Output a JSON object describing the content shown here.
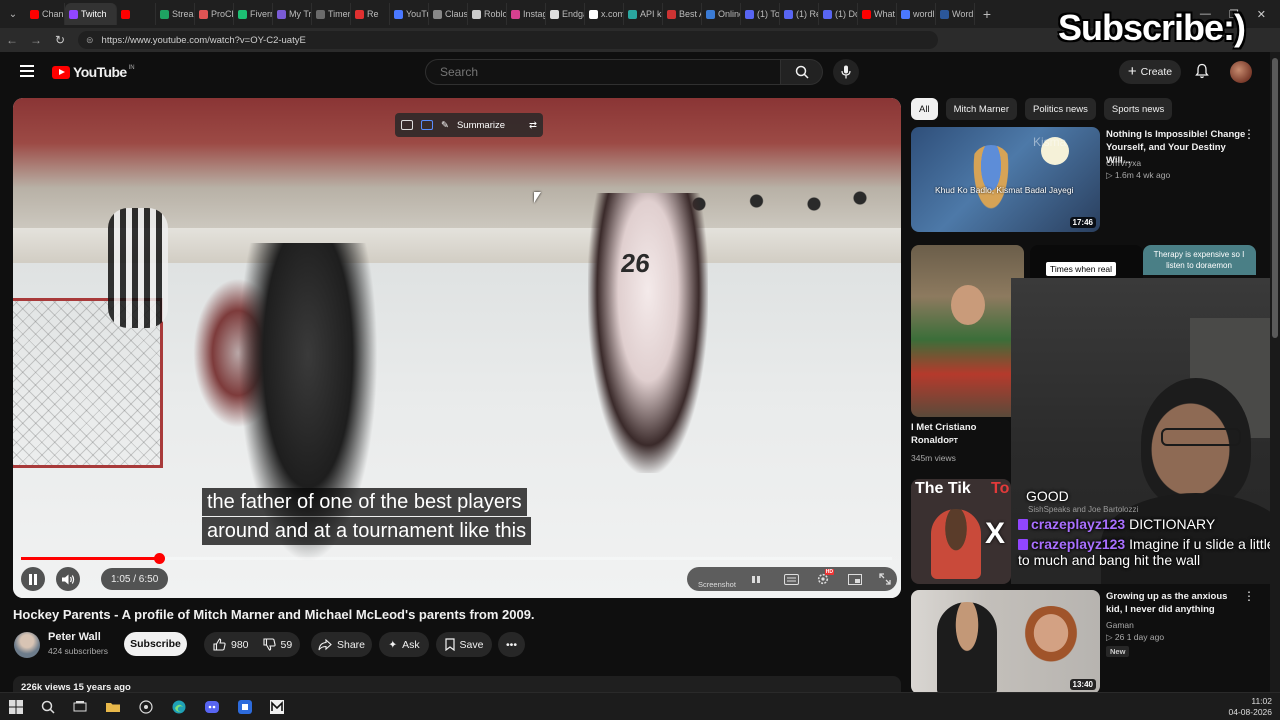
{
  "browser": {
    "tabs": [
      {
        "label": "Chann",
        "color": "#ff0000"
      },
      {
        "label": "Twitch",
        "color": "#9146ff",
        "active": true
      },
      {
        "label": "",
        "color": "#ff0000"
      },
      {
        "label": "Strean",
        "color": "#1ea362"
      },
      {
        "label": "ProCh",
        "color": "#e05454"
      },
      {
        "label": "Fiverr",
        "color": "#1dbf73"
      },
      {
        "label": "My Tr",
        "color": "#7a5bd6"
      },
      {
        "label": "Timers",
        "color": "#6a6a6a"
      },
      {
        "label": "Re",
        "color": "#e03030"
      },
      {
        "label": "YouTu",
        "color": "#4a78ff"
      },
      {
        "label": "Claust",
        "color": "#888888"
      },
      {
        "label": "Roblo",
        "color": "#cccccc"
      },
      {
        "label": "Instag",
        "color": "#d6408f"
      },
      {
        "label": "Endga",
        "color": "#dddddd"
      },
      {
        "label": "x.com",
        "color": "#ffffff"
      },
      {
        "label": "API ke",
        "color": "#2aa7a0"
      },
      {
        "label": "Best A",
        "color": "#cc3333"
      },
      {
        "label": "Onlinc",
        "color": "#3a7bd5"
      },
      {
        "label": "(1) To",
        "color": "#5865f2"
      },
      {
        "label": "(1) Re",
        "color": "#5865f2"
      },
      {
        "label": "(1) Dc",
        "color": "#5865f2"
      },
      {
        "label": "What i",
        "color": "#ff0000"
      },
      {
        "label": "wordli",
        "color": "#4a78ff"
      },
      {
        "label": "Word",
        "color": "#2b579a"
      }
    ],
    "url": "https://www.youtube.com/watch?v=OY-C2-uatyE"
  },
  "header": {
    "logo_text": "YouTube",
    "region": "IN",
    "search_placeholder": "Search",
    "create_label": "Create"
  },
  "player": {
    "toolbar_summarize": "Summarize",
    "caption_lines": [
      "the father of one of the best players",
      "around and at a tournament like this"
    ],
    "jersey_number": "26",
    "time_display": "1:05 / 6:50",
    "progress": 0.159,
    "screenshot_label": "Screenshot",
    "hd_badge": "HD"
  },
  "video": {
    "title": "Hockey Parents - A profile of Mitch Marner and Michael McLeod's parents from 2009.",
    "channel": "Peter Wall",
    "subscribers": "424 subscribers",
    "subscribe_label": "Subscribe",
    "likes": "980",
    "dislikes": "59",
    "share_label": "Share",
    "ask_label": "Ask",
    "save_label": "Save",
    "views_age": "226k views  15 years ago"
  },
  "sidebar": {
    "chips": [
      "All",
      "Mitch Marner",
      "Politics news",
      "Sports news"
    ],
    "rec1": {
      "title": "Nothing Is Impossible! Change Yourself, and Your Destiny Will...",
      "channel": "OmVryxa",
      "meta": "▷ 1.6m  4 wk ago",
      "thumb_text": "Khud Ko Badlo, Kismat Badal Jayegi",
      "thumb_brand": "Kisma",
      "duration": "17:46"
    },
    "short1": {
      "title": "I Met Cristiano Ronaldo",
      "suffix": "PT",
      "views": "345m views"
    },
    "short2": {
      "label": "Times when real"
    },
    "short3": {
      "text": "Therapy is expensive so I listen to doraemon"
    },
    "rec3": {
      "thumb_text_a": "The Tik",
      "thumb_text_b": "To",
      "channel_hint": "SishSpeaks"
    },
    "rec4": {
      "title": "Growing up as the anxious kid, I never did anything",
      "channel": "Gaman",
      "meta": "▷ 26  1 day ago",
      "badge": "New",
      "duration": "13:40"
    }
  },
  "overlay": {
    "subscribe_text": "Subscribe:)",
    "chat": [
      {
        "user": "",
        "text": "GOOD"
      },
      {
        "user": "crazeplayz123",
        "text": "DICTIONARY"
      },
      {
        "user": "crazeplayz123",
        "text": "Imagine if u slide a little to much and bang hit the wall"
      }
    ],
    "chat_faint": "SishSpeaks and Joe Bartolozzi",
    "x_mark": "X"
  },
  "taskbar": {
    "time": "11:02",
    "date": "04-08-2026"
  },
  "colors": {
    "youtube_red": "#ff0000",
    "twitch_purple": "#9146ff",
    "background": "#0f0f0f"
  }
}
